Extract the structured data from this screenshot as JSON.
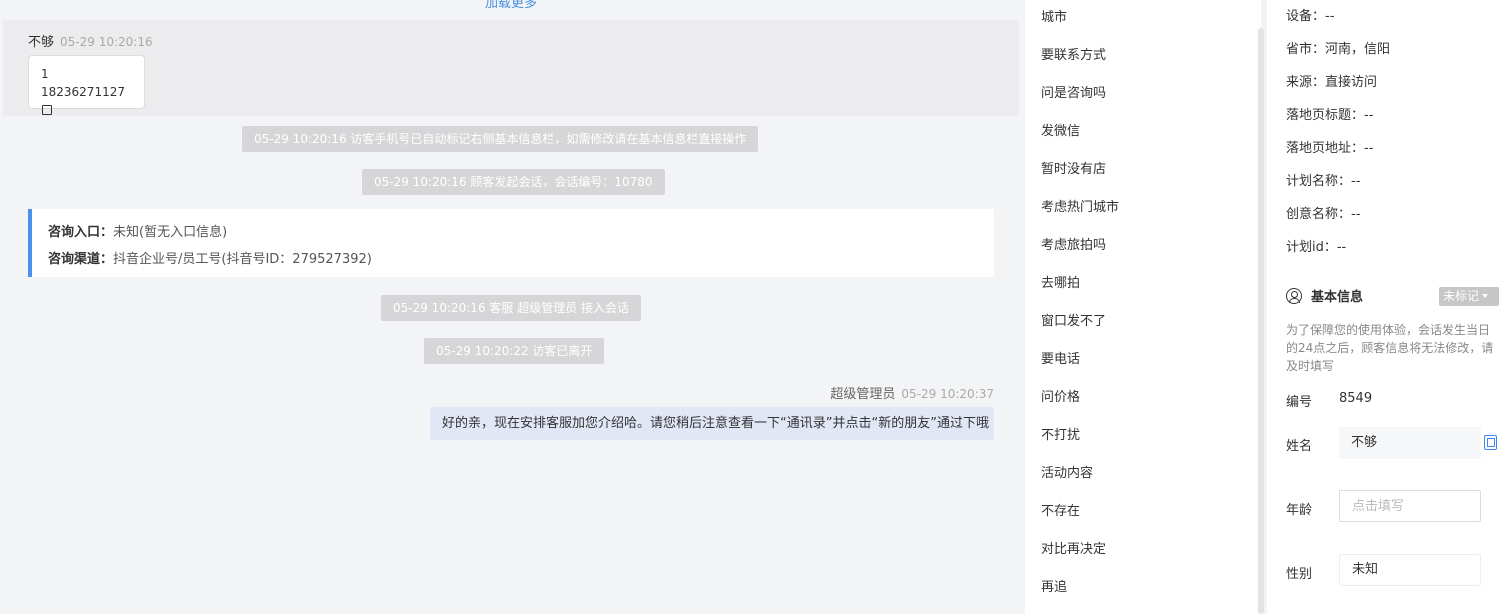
{
  "chat": {
    "load_more": "加载更多",
    "visitor_name": "不够",
    "visitor_time": "05-29 10:20:16",
    "card_line1": "1",
    "card_line2": "18236271127",
    "sys1": "05-29 10:20:16 访客手机号已自动标记右侧基本信息栏，如需修改请在基本信息栏直接操作",
    "sys2": "05-29 10:20:16 顾客发起会话，会话编号：10780",
    "entry_label": "咨询入口：",
    "entry_value": "未知(暂无入口信息)",
    "channel_label": "咨询渠道：",
    "channel_value": "抖音企业号/员工号(抖音号ID：279527392)",
    "sys3": "05-29 10:20:16 客服 超级管理员 接入会话",
    "sys4": "05-29 10:20:22 访客已离开",
    "agent_name": "超级管理员",
    "agent_time": "05-29 10:20:37",
    "agent_message": "好的亲，现在安排客服加您介绍哈。请您稍后注意查看一下“通讯录”并点击“新的朋友”通过下哦"
  },
  "quick_replies": [
    "城市",
    "要联系方式",
    "问是咨询吗",
    "发微信",
    "暂时没有店",
    "考虑热门城市",
    "考虑旅拍吗",
    "去哪拍",
    "窗口发不了",
    "要电话",
    "问价格",
    "不打扰",
    "活动内容",
    "不存在",
    "对比再决定",
    "再追"
  ],
  "info": {
    "device": "设备：--",
    "province": "省市：河南，信阳",
    "source": "来源：直接访问",
    "landing_title": "落地页标题：--",
    "landing_url": "落地页地址：--",
    "plan_name": "计划名称：--",
    "creative_name": "创意名称：--",
    "plan_id": "计划id：--",
    "basic_title": "基本信息",
    "tag_button": "未标记",
    "notice": "为了保障您的使用体验，会话发生当日的24点之后，顾客信息将无法修改，请及时填写",
    "id_label": "编号",
    "id_value": "8549",
    "name_label": "姓名",
    "name_value": "不够",
    "age_label": "年龄",
    "age_placeholder": "点击填写",
    "gender_label": "性别",
    "gender_value": "未知"
  }
}
